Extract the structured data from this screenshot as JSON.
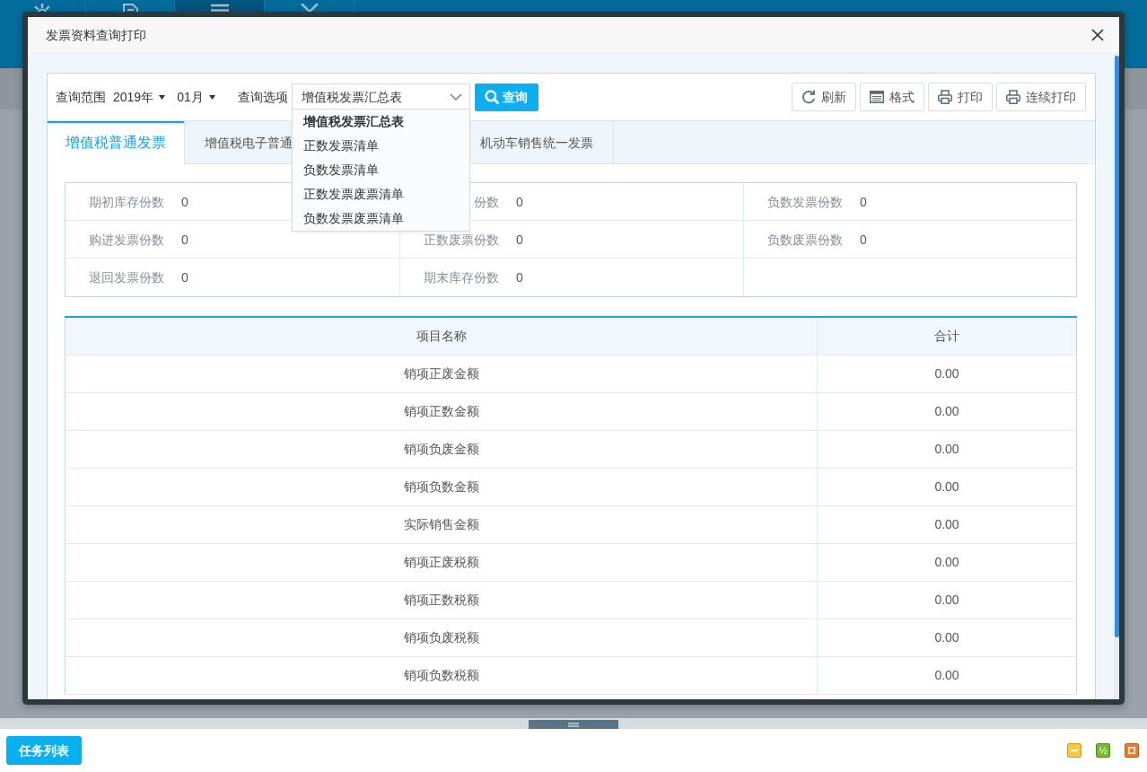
{
  "app": {
    "nav": [
      {
        "selected": false
      },
      {
        "selected": false
      },
      {
        "selected": true
      },
      {
        "selected": false
      }
    ]
  },
  "dialog": {
    "title": "发票资料查询打印",
    "query": {
      "range_label": "查询范围",
      "year": "2019年",
      "month": "01月",
      "option_label": "查询选项",
      "option_value": "增值税发票汇总表",
      "search_button": "查询",
      "options": [
        {
          "label": "增值税发票汇总表",
          "selected": true
        },
        {
          "label": "正数发票清单",
          "selected": false
        },
        {
          "label": "负数发票清单",
          "selected": false
        },
        {
          "label": "正数发票废票清单",
          "selected": false
        },
        {
          "label": "负数发票废票清单",
          "selected": false
        }
      ]
    },
    "toolbar": [
      "刷新",
      "格式",
      "打印",
      "连续打印"
    ],
    "tabs": [
      {
        "label": "增值税普通发票",
        "selected": true
      },
      {
        "label": "增值税电子普通",
        "selected": false
      },
      {
        "label": "机动车销售统一发票",
        "selected": false
      }
    ],
    "stats": [
      [
        {
          "label": "期初库存份数",
          "value": "0"
        },
        {
          "label": "份数",
          "value": "0"
        },
        {
          "label": "负数发票份数",
          "value": "0"
        }
      ],
      [
        {
          "label": "购进发票份数",
          "value": "0"
        },
        {
          "label": "正数废票份数",
          "value": "0"
        },
        {
          "label": "负数废票份数",
          "value": "0"
        }
      ],
      [
        {
          "label": "退回发票份数",
          "value": "0"
        },
        {
          "label": "期末库存份数",
          "value": "0"
        }
      ]
    ],
    "table": {
      "columns": [
        "项目名称",
        "合计"
      ],
      "rows": [
        [
          "销项正废金额",
          "0.00"
        ],
        [
          "销项正数金额",
          "0.00"
        ],
        [
          "销项负废金额",
          "0.00"
        ],
        [
          "销项负数金额",
          "0.00"
        ],
        [
          "实际销售金额",
          "0.00"
        ],
        [
          "销项正废税额",
          "0.00"
        ],
        [
          "销项正数税额",
          "0.00"
        ],
        [
          "销项负废税额",
          "0.00"
        ],
        [
          "销项负数税额",
          "0.00"
        ]
      ]
    }
  },
  "taskbar": {
    "button": "任务列表",
    "tray": [
      {
        "kind": "minimize"
      },
      {
        "kind": "half",
        "label": "½"
      },
      {
        "kind": "maximize"
      }
    ]
  }
}
